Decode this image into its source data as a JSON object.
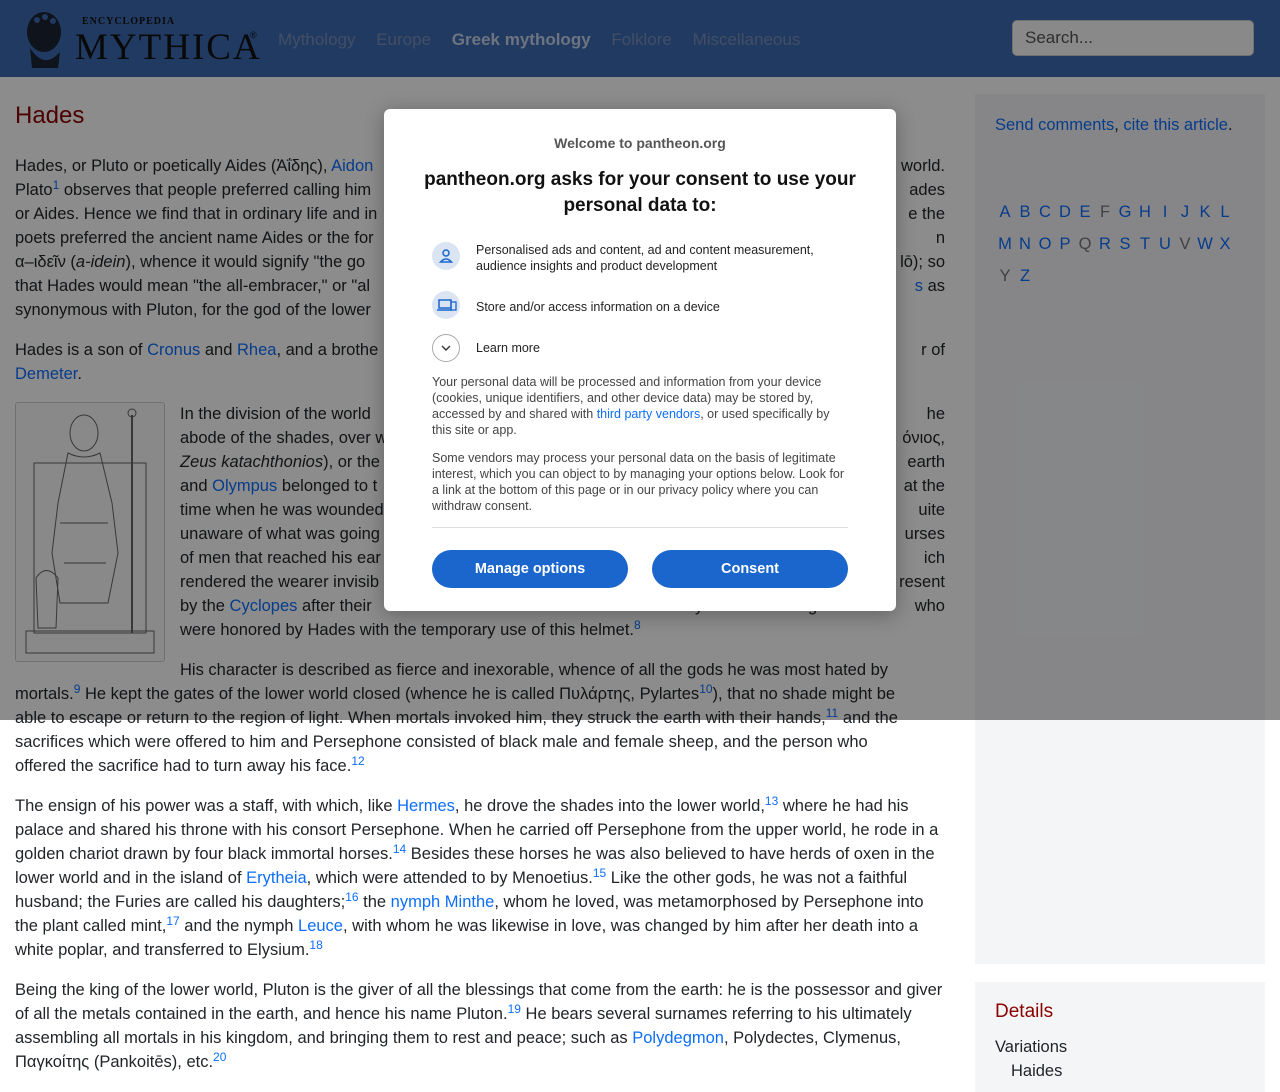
{
  "header": {
    "logo_top": "ENCYCLOPEDIA",
    "logo_main": "MYTHICA",
    "logo_tm": "®",
    "nav": [
      "Mythology",
      "Europe",
      "Greek mythology",
      "Folklore",
      "Miscellaneous"
    ],
    "search_placeholder": "Search..."
  },
  "article": {
    "title": "Hades",
    "p1": {
      "a": "Hades, or Pluto or poetically Aides (Ἀΐδης), ",
      "a_link": "Aidon",
      "b": "",
      "b_end": "world.",
      "l2a": "Plato",
      "l2b": " observes that people preferred calling him",
      "l2c": "ades",
      "l3a": "or Aides. Hence we find that in ordinary life and in",
      "l3b": "e the",
      "l4a": "poets preferred the ancient name Aides or the for",
      "l4b": "n",
      "l5a": "α–ιδεῖν (",
      "l5b": "a-idein",
      "l5c": "), whence it would signify \"the go",
      "l5d": "lō); so",
      "l6a": "that Hades would mean \"the all-embracer,\" or \"al",
      "l6b": "s",
      "l6c": " as",
      "l7": "synonymous with Pluton, for the god of the lower"
    },
    "p2": {
      "a": "Hades is a son of ",
      "cronus": "Cronus",
      "and": " and ",
      "rhea": "Rhea",
      "b": ", and a brothe",
      "c": "r of",
      "demeter": "Demeter",
      "d": "."
    },
    "p3": {
      "l1a": "In the division of the world",
      "l1b": "he",
      "l2a": "abode of the shades, over w",
      "l2b": "όνιος,",
      "l3a": "Zeus katachthonios",
      "l3b": "), or the",
      "l3c": "earth",
      "l4a": "and ",
      "olympus": "Olympus",
      "l4b": " belonged to t",
      "l4c": "at the",
      "l5a": "time when he was wounded",
      "l5b": "uite",
      "l6a": "unaware of what was going",
      "l6b": "urses",
      "l7a": "of men that reached his ear",
      "l7b": "ich",
      "l8a": "rendered the wearer invisib",
      "l8b": "resent",
      "l9a": "by the ",
      "cyclopes": "Cyclopes",
      "l9b": " after their",
      "l9c": "y",
      "l9d": "g",
      "l9e": "who",
      "l10": "were honored by Hades with the temporary use of this helmet.",
      "ref8": "8"
    },
    "p4": {
      "l1": "His character is described as fierce and inexorable, whence of all the gods he was most hated by",
      "l2a": "mortals.",
      "ref9": "9",
      "l2b": " He kept the gates of the lower world closed (whence he is called Πυλάρτης, Pylartes",
      "ref10": "10",
      "l2c": "), that no shade might be",
      "l3a": "able to escape or return to the region of light. When mortals invoked him, they struck the earth with their hands,",
      "ref11": "11",
      "l3b": " and the",
      "l4": "sacrifices which were offered to him and Persephone consisted of black male and female sheep, and the person who",
      "l5": "offered the sacrifice had to turn away his face.",
      "ref12": "12"
    },
    "p5": {
      "a": "The ensign of his power was a staff, with which, like ",
      "hermes": "Hermes",
      "b": ", he drove the shades into the lower world,",
      "ref13": "13",
      "c": " where he had his palace and shared his throne with his consort Persephone. When he carried off Persephone from the upper world, he rode in a golden chariot drawn by four black immortal horses.",
      "ref14": "14",
      "d": " Besides these horses he was also believed to have herds of oxen in the lower world and in the island of ",
      "erytheia": "Erytheia",
      "e": ", which were attended to by Menoetius.",
      "ref15": "15",
      "f": " Like the other gods, he was not a faithful husband; the Furies are called his daughters;",
      "ref16": "16",
      "g": " the ",
      "minthe": "nymph Minthe",
      "h": ", whom he loved, was metamorphosed by Persephone into the plant called mint,",
      "ref17": "17",
      "i": " and the nymph ",
      "leuce": "Leuce",
      "j": ", with whom he was likewise in love, was changed by him after her death into a white poplar, and transferred to Elysium.",
      "ref18": "18"
    },
    "p6": {
      "a": "Being the king of the lower world, Pluton is the giver of all the blessings that come from the earth: he is the possessor and giver of all the metals contained in the earth, and hence his name Pluton.",
      "ref19": "19",
      "b": " He bears several surnames referring to his ultimately assembling all mortals in his kingdom, and bringing them to rest and peace; such as ",
      "polydegmon": "Polydegmon",
      "c": ", Polydectes, Clymenus, Παγκοίτης (Pankoitēs), etc.",
      "ref20": "20"
    },
    "ref1": "1"
  },
  "sidebar": {
    "send": "Send comments",
    "comma": ", ",
    "cite": "cite this article",
    "dot": ".",
    "letters": [
      "A",
      "B",
      "C",
      "D",
      "E",
      "F",
      "G",
      "H",
      "I",
      "J",
      "K",
      "L",
      "M",
      "N",
      "O",
      "P",
      "Q",
      "R",
      "S",
      "T",
      "U",
      "V",
      "W",
      "X",
      "Y",
      "Z"
    ],
    "disabled_letters": [
      "F",
      "Q",
      "V",
      "Y"
    ],
    "details_title": "Details",
    "variations_label": "Variations",
    "variation_1": "Haides"
  },
  "consent": {
    "welcome": "Welcome to pantheon.org",
    "heading": "pantheon.org asks for your consent to use your personal data to:",
    "purpose_1": "Personalised ads and content, ad and content measurement, audience insights and product development",
    "purpose_2": "Store and/or access information on a device",
    "learn_more": "Learn more",
    "text1a": "Your personal data will be processed and information from your device (cookies, unique identifiers, and other device data) may be stored by, accessed by and shared with ",
    "text1_link": "third party vendors",
    "text1b": ", or used specifically by this site or app.",
    "text2": "Some vendors may process your personal data on the basis of legitimate interest, which you can object to by managing your options below. Look for a link at the bottom of this page or in our privacy policy where you can withdraw consent.",
    "manage_btn": "Manage options",
    "consent_btn": "Consent"
  }
}
